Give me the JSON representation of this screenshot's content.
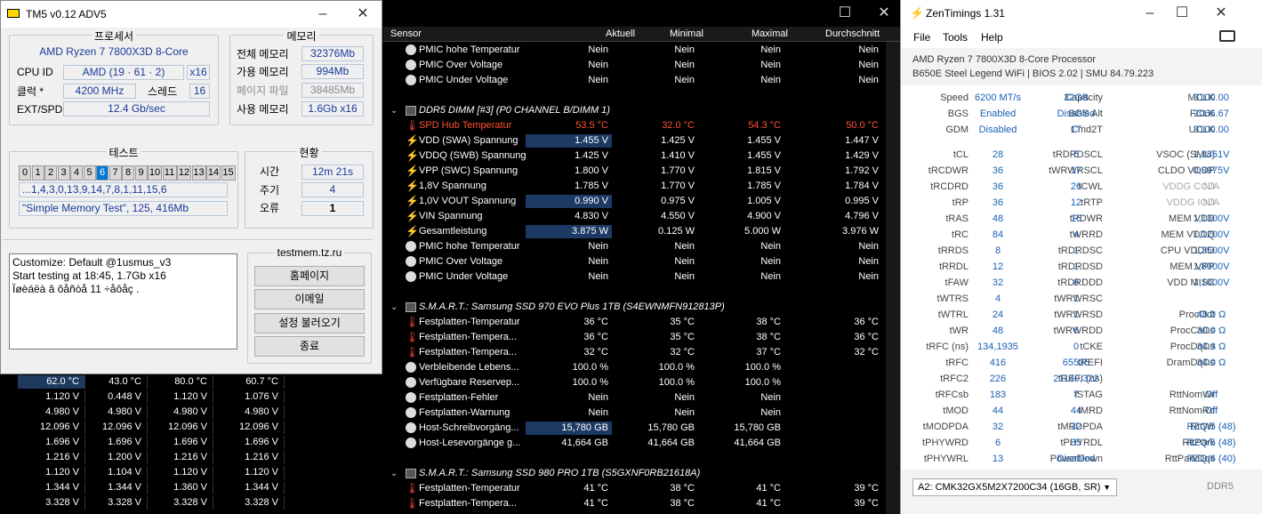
{
  "tm5": {
    "title": "TM5 v0.12 ADV5",
    "processor_label": "프로세서",
    "cpu_name": "AMD Ryzen 7 7800X3D 8-Core",
    "cpuid_label": "CPU ID",
    "cpuid_value": "AMD (19 · 61 · 2)",
    "cpuid_threads": "x16",
    "clock_label": "클럭 *",
    "clock_value": "4200 MHz",
    "threads_label": "스레드",
    "threads_value": "16",
    "extspd_label": "EXT/SPD",
    "extspd_value": "12.4 Gb/sec",
    "memory_label": "메모리",
    "total_mem_label": "전체 메모리",
    "total_mem_value": "32376Mb",
    "avail_mem_label": "가용 메모리",
    "avail_mem_value": "994Mb",
    "page_file_label": "페이지 파일",
    "page_file_value": "38485Mb",
    "used_mem_label": "사용 메모리",
    "used_mem_value": "1.6Gb x16",
    "test_label": "테스트",
    "test_cells": [
      "0",
      "1",
      "2",
      "3",
      "4",
      "5",
      "6",
      "7",
      "8",
      "9",
      "10",
      "11",
      "12",
      "13",
      "14",
      "15"
    ],
    "active_test": "6",
    "sequence": "...1,4,3,0,13,9,14,7,8,1,11,15,6",
    "config": "\"Simple Memory Test\", 125, 416Mb",
    "status_label": "현황",
    "time_label": "시간",
    "time_value": "12m 21s",
    "cycle_label": "주기",
    "cycle_value": "4",
    "error_label": "오류",
    "error_value": "1",
    "log_lines": [
      "Customize: Default @1usmus_v3",
      "Start testing at 18:45, 1.7Gb x16",
      "Ïøèáëà â ôåñòå 11 ÷åôåç ."
    ],
    "site_label": "testmem.tz.ru",
    "btn_home": "홈페이지",
    "btn_email": "이메일",
    "btn_load": "설정 불러오기",
    "btn_exit": "종료"
  },
  "bg_rows": [
    [
      "62.0 °C",
      "43.0 °C",
      "80.0 °C",
      "60.7 °C"
    ],
    [
      "1.120 V",
      "0.448 V",
      "1.120 V",
      "1.076 V"
    ],
    [
      "4.980 V",
      "4.980 V",
      "4.980 V",
      "4.980 V"
    ],
    [
      "12.096 V",
      "12.096 V",
      "12.096 V",
      "12.096 V"
    ],
    [
      "1.696 V",
      "1.696 V",
      "1.696 V",
      "1.696 V"
    ],
    [
      "1.216 V",
      "1.200 V",
      "1.216 V",
      "1.216 V"
    ],
    [
      "1.120 V",
      "1.104 V",
      "1.120 V",
      "1.120 V"
    ],
    [
      "1.344 V",
      "1.344 V",
      "1.360 V",
      "1.344 V"
    ],
    [
      "3.328 V",
      "3.328 V",
      "3.328 V",
      "3.328 V"
    ]
  ],
  "hw": {
    "columns": [
      "Sensor",
      "Aktuell",
      "Minimal",
      "Maximal",
      "Durchschnitt"
    ],
    "rows": [
      {
        "k": "r",
        "icon": "circle",
        "label": "PMIC hohe Temperatur",
        "vals": [
          "Nein",
          "Nein",
          "Nein",
          "Nein"
        ]
      },
      {
        "k": "r",
        "icon": "circle",
        "label": "PMIC Over Voltage",
        "vals": [
          "Nein",
          "Nein",
          "Nein",
          "Nein"
        ]
      },
      {
        "k": "r",
        "icon": "circle",
        "label": "PMIC Under Voltage",
        "vals": [
          "Nein",
          "Nein",
          "Nein",
          "Nein"
        ]
      },
      {
        "k": "blank"
      },
      {
        "k": "g",
        "label": "DDR5 DIMM [#3] (P0 CHANNEL B/DIMM 1)"
      },
      {
        "k": "r",
        "icon": "therm",
        "red": true,
        "label": "SPD Hub Temperatur",
        "vals": [
          "53.5 °C",
          "32.0 °C",
          "54.3 °C",
          "50.0 °C"
        ]
      },
      {
        "k": "r",
        "icon": "bolt",
        "hl": true,
        "label": "VDD (SWA) Spannung",
        "vals": [
          "1.455 V",
          "1.425 V",
          "1.455 V",
          "1.447 V"
        ]
      },
      {
        "k": "r",
        "icon": "bolt",
        "label": "VDDQ (SWB) Spannung",
        "vals": [
          "1.425 V",
          "1.410 V",
          "1.455 V",
          "1.429 V"
        ]
      },
      {
        "k": "r",
        "icon": "bolt",
        "label": "VPP (SWC) Spannung",
        "vals": [
          "1.800 V",
          "1.770 V",
          "1.815 V",
          "1.792 V"
        ]
      },
      {
        "k": "r",
        "icon": "bolt",
        "label": "1,8V Spannung",
        "vals": [
          "1.785 V",
          "1.770 V",
          "1.785 V",
          "1.784 V"
        ]
      },
      {
        "k": "r",
        "icon": "bolt",
        "hl": true,
        "label": "1,0V VOUT Spannung",
        "vals": [
          "0.990 V",
          "0.975 V",
          "1.005 V",
          "0.995 V"
        ]
      },
      {
        "k": "r",
        "icon": "bolt",
        "label": "VIN Spannung",
        "vals": [
          "4.830 V",
          "4.550 V",
          "4.900 V",
          "4.796 V"
        ]
      },
      {
        "k": "r",
        "icon": "bolt",
        "hl": true,
        "label": "Gesamtleistung",
        "vals": [
          "3.875 W",
          "0.125 W",
          "5.000 W",
          "3.976 W"
        ]
      },
      {
        "k": "r",
        "icon": "circle",
        "label": "PMIC hohe Temperatur",
        "vals": [
          "Nein",
          "Nein",
          "Nein",
          "Nein"
        ]
      },
      {
        "k": "r",
        "icon": "circle",
        "label": "PMIC Over Voltage",
        "vals": [
          "Nein",
          "Nein",
          "Nein",
          "Nein"
        ]
      },
      {
        "k": "r",
        "icon": "circle",
        "label": "PMIC Under Voltage",
        "vals": [
          "Nein",
          "Nein",
          "Nein",
          "Nein"
        ]
      },
      {
        "k": "blank"
      },
      {
        "k": "g",
        "label": "S.M.A.R.T.: Samsung SSD 970 EVO Plus 1TB (S4EWNMFN912813P)"
      },
      {
        "k": "r",
        "icon": "therm",
        "label": "Festplatten-Temperatur",
        "vals": [
          "36 °C",
          "35 °C",
          "38 °C",
          "36 °C"
        ]
      },
      {
        "k": "r",
        "icon": "therm",
        "label": "Festplatten-Tempera...",
        "vals": [
          "36 °C",
          "35 °C",
          "38 °C",
          "36 °C"
        ]
      },
      {
        "k": "r",
        "icon": "therm",
        "label": "Festplatten-Tempera...",
        "vals": [
          "32 °C",
          "32 °C",
          "37 °C",
          "32 °C"
        ]
      },
      {
        "k": "r",
        "icon": "circle",
        "label": "Verbleibende Lebens...",
        "vals": [
          "100.0 %",
          "100.0 %",
          "100.0 %",
          ""
        ]
      },
      {
        "k": "r",
        "icon": "circle",
        "label": "Verfügbare Reservep...",
        "vals": [
          "100.0 %",
          "100.0 %",
          "100.0 %",
          ""
        ]
      },
      {
        "k": "r",
        "icon": "circle",
        "label": "Festplatten-Fehler",
        "vals": [
          "Nein",
          "Nein",
          "Nein",
          ""
        ]
      },
      {
        "k": "r",
        "icon": "circle",
        "label": "Festplatten-Warnung",
        "vals": [
          "Nein",
          "Nein",
          "Nein",
          ""
        ]
      },
      {
        "k": "r",
        "icon": "circle",
        "hl": true,
        "label": "Host-Schreibvorgäng...",
        "vals": [
          "15,780 GB",
          "15,780 GB",
          "15,780 GB",
          ""
        ]
      },
      {
        "k": "r",
        "icon": "circle",
        "label": "Host-Lesevorgänge g...",
        "vals": [
          "41,664 GB",
          "41,664 GB",
          "41,664 GB",
          ""
        ]
      },
      {
        "k": "blank"
      },
      {
        "k": "g",
        "label": "S.M.A.R.T.: Samsung SSD 980 PRO 1TB (S5GXNF0RB21618A)"
      },
      {
        "k": "r",
        "icon": "therm",
        "label": "Festplatten-Temperatur",
        "vals": [
          "41 °C",
          "38 °C",
          "41 °C",
          "39 °C"
        ]
      },
      {
        "k": "r",
        "icon": "therm",
        "label": "Festplatten-Tempera...",
        "vals": [
          "41 °C",
          "38 °C",
          "41 °C",
          "39 °C"
        ]
      }
    ]
  },
  "zt": {
    "title": "ZenTimings 1.31",
    "menu": [
      "File",
      "Tools",
      "Help"
    ],
    "cpu": "AMD Ryzen 7 7800X3D 8-Core Processor",
    "board": "B650E Steel Legend WiFi | BIOS 2.02 | SMU 84.79.223",
    "top": [
      [
        [
          "Speed",
          "6200 MT/s"
        ],
        [
          "Capacity",
          "32GB"
        ],
        [
          "MCLK",
          "3100.00"
        ]
      ],
      [
        [
          "BGS",
          "Enabled"
        ],
        [
          "BGS Alt",
          "Disabled"
        ],
        [
          "FCLK",
          "2066.67"
        ]
      ],
      [
        [
          "GDM",
          "Disabled"
        ],
        [
          "Cmd2T",
          "1T"
        ],
        [
          "UCLK",
          "3100.00"
        ]
      ]
    ],
    "timings": [
      [
        [
          "tCL",
          "28"
        ],
        [
          "tRDRDSCL",
          "5"
        ],
        [
          "VSOC (SMU)",
          "1,1851V"
        ]
      ],
      [
        [
          "tRCDWR",
          "36"
        ],
        [
          "tWRWRSCL",
          "17"
        ],
        [
          "CLDO VDDP",
          "0,9975V"
        ]
      ],
      [
        [
          "tRCDRD",
          "36"
        ],
        [
          "tCWL",
          "26"
        ],
        [
          "VDDG CCD",
          "N/A"
        ]
      ],
      [
        [
          "tRP",
          "36"
        ],
        [
          "tRTP",
          "12"
        ],
        [
          "VDDG IOD",
          "N/A"
        ]
      ],
      [
        [
          "tRAS",
          "48"
        ],
        [
          "tRDWR",
          "16"
        ],
        [
          "MEM VDD",
          "1,1300V"
        ]
      ],
      [
        [
          "tRC",
          "84"
        ],
        [
          "tWRRD",
          "4"
        ],
        [
          "MEM VDDQ",
          "1,1200V"
        ]
      ],
      [
        [
          "tRRDS",
          "8"
        ],
        [
          "tRDRDSC",
          "1"
        ],
        [
          "CPU VDDIO",
          "1,3500V"
        ]
      ],
      [
        [
          "tRRDL",
          "12"
        ],
        [
          "tRDRDSD",
          "1"
        ],
        [
          "MEM VPP",
          "1,8000V"
        ]
      ],
      [
        [
          "tFAW",
          "32"
        ],
        [
          "tRDRDDD",
          "8"
        ],
        [
          "VDD MISC",
          "1,1000V"
        ]
      ],
      [
        [
          "tWTRS",
          "4"
        ],
        [
          "tWRWRSC",
          "1"
        ],
        [
          "",
          ""
        ]
      ],
      [
        [
          "tWTRL",
          "24"
        ],
        [
          "tWRWRSD",
          "1"
        ],
        [
          "ProcOdt",
          "48.0 Ω"
        ]
      ],
      [
        [
          "tWR",
          "48"
        ],
        [
          "tWRWRDD",
          "6"
        ],
        [
          "ProcCaDs",
          "30.0 Ω"
        ]
      ],
      [
        [
          "tRFC (ns)",
          "134,1935"
        ],
        [
          "tCKE",
          "0"
        ],
        [
          "ProcDqDs",
          "34.3 Ω"
        ]
      ],
      [
        [
          "tRFC",
          "416"
        ],
        [
          "tREFI",
          "65535"
        ],
        [
          "DramDqDs",
          "34.0 Ω"
        ]
      ],
      [
        [
          "tRFC2",
          "226"
        ],
        [
          "tREFI (ns)",
          "21140,322"
        ],
        [
          "",
          ""
        ]
      ],
      [
        [
          "tRFCsb",
          "183"
        ],
        [
          "tSTAG",
          "7"
        ],
        [
          "RttNomWr",
          "Off"
        ]
      ],
      [
        [
          "tMOD",
          "44"
        ],
        [
          "tMRD",
          "44"
        ],
        [
          "RttNomRd",
          "Off"
        ]
      ],
      [
        [
          "tMODPDA",
          "32"
        ],
        [
          "tMRDPDA",
          "32"
        ],
        [
          "RttWr",
          "RZQ/5 (48)"
        ]
      ],
      [
        [
          "tPHYWRD",
          "6"
        ],
        [
          "tPHYRDL",
          "35"
        ],
        [
          "RttPark",
          "RZQ/5 (48)"
        ]
      ],
      [
        [
          "tPHYWRL",
          "13"
        ],
        [
          "PowerDown",
          "Disabled"
        ],
        [
          "RttParkDqs",
          "RZQ/6 (40)"
        ]
      ]
    ],
    "dimm_select": "A2: CMK32GX5M2X7200C34 (16GB, SR)",
    "mem_type": "DDR5"
  }
}
